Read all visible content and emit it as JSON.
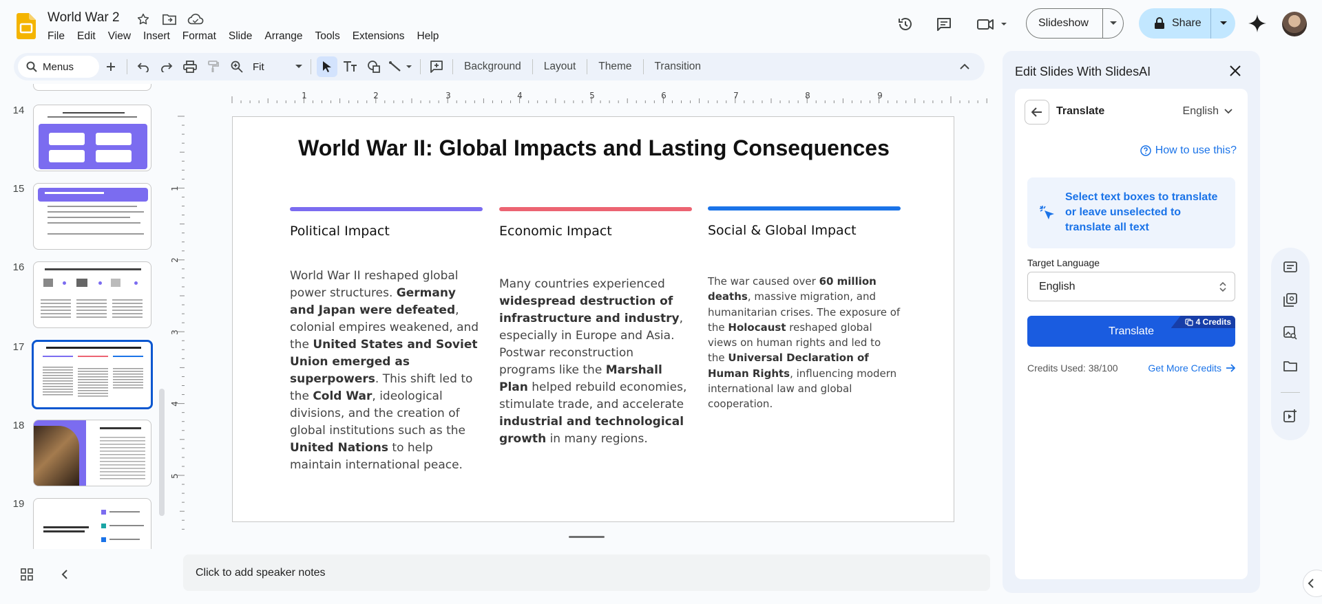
{
  "app": {
    "doc_title": "World War 2",
    "menu": [
      "File",
      "Edit",
      "View",
      "Insert",
      "Format",
      "Slide",
      "Arrange",
      "Tools",
      "Extensions",
      "Help"
    ],
    "slideshow_label": "Slideshow",
    "share_label": "Share"
  },
  "toolbar": {
    "menus_label": "Menus",
    "zoom_value": "Fit",
    "background_label": "Background",
    "layout_label": "Layout",
    "theme_label": "Theme",
    "transition_label": "Transition"
  },
  "filmstrip": {
    "numbers": [
      "14",
      "15",
      "16",
      "17",
      "18",
      "19"
    ],
    "selected": "17"
  },
  "rulers": {
    "h": [
      "1",
      "2",
      "3",
      "4",
      "5",
      "6",
      "7",
      "8",
      "9"
    ],
    "v": [
      "1",
      "2",
      "3",
      "4",
      "5"
    ]
  },
  "slide": {
    "title": "World War II: Global Impacts and Lasting Consequences",
    "columns": [
      {
        "heading": "Political Impact",
        "accent": "#7b6cf0",
        "segments": [
          {
            "t": "World War II reshaped global power structures. ",
            "b": false
          },
          {
            "t": "Germany and Japan were defeated",
            "b": true
          },
          {
            "t": ", colonial empires weakened, and the ",
            "b": false
          },
          {
            "t": "United States and Soviet Union emerged as superpowers",
            "b": true
          },
          {
            "t": ". This shift led to the ",
            "b": false
          },
          {
            "t": "Cold War",
            "b": true
          },
          {
            "t": ", ideological divisions, and the creation of global institutions such as the ",
            "b": false
          },
          {
            "t": "United Nations",
            "b": true
          },
          {
            "t": " to help maintain international peace.",
            "b": false
          }
        ]
      },
      {
        "heading": "Economic Impact",
        "accent": "#ec6472",
        "segments": [
          {
            "t": "Many countries experienced ",
            "b": false
          },
          {
            "t": "widespread destruction of infrastructure and industry",
            "b": true
          },
          {
            "t": ", especially in Europe and Asia. Postwar reconstruction programs like the ",
            "b": false
          },
          {
            "t": "Marshall Plan",
            "b": true
          },
          {
            "t": " helped rebuild economies, stimulate trade, and accelerate ",
            "b": false
          },
          {
            "t": "industrial and technological growth",
            "b": true
          },
          {
            "t": " in many regions.",
            "b": false
          }
        ]
      },
      {
        "heading": "Social & Global Impact",
        "accent": "#1a73e8",
        "segments": [
          {
            "t": "The war caused over ",
            "b": false
          },
          {
            "t": "60 million deaths",
            "b": true
          },
          {
            "t": ", massive migration, and humanitarian crises. The exposure of the ",
            "b": false
          },
          {
            "t": "Holocaust",
            "b": true
          },
          {
            "t": " reshaped global views on human rights and led to the ",
            "b": false
          },
          {
            "t": "Universal Declaration of Human Rights",
            "b": true
          },
          {
            "t": ", influencing modern international law and global cooperation.",
            "b": false
          }
        ]
      }
    ]
  },
  "speaker_notes": {
    "placeholder": "Click to add speaker notes"
  },
  "panel": {
    "title": "Edit Slides With SlidesAI",
    "translate_label": "Translate",
    "language_top": "English",
    "how_to": "How to use this?",
    "info_text": "Select text boxes to translate or leave unselected to translate all text",
    "target_label": "Target Language",
    "target_value": "English",
    "translate_button": "Translate",
    "credits_badge": "4 Credits",
    "credits_used": "Credits Used: 38/100",
    "get_more": "Get More Credits"
  },
  "colors": {
    "accent_blue": "#1a73e8",
    "share_bg": "#c2e7ff",
    "toolbar_bg": "#edf2fa",
    "selection": "#0b57d0"
  }
}
